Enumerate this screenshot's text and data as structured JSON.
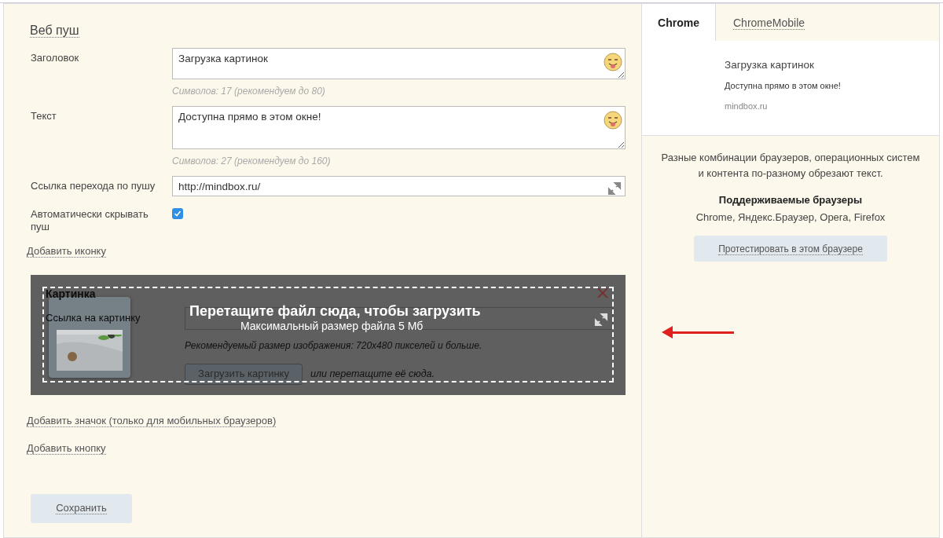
{
  "section_title": "Веб пуш",
  "fields": [
    {
      "kind": "textarea",
      "label": "Заголовок",
      "value": "Загрузка картинок",
      "hint": "Символов: 17 (рекомендуем до 80)"
    },
    {
      "kind": "textarea",
      "label": "Текст",
      "value": "Доступна прямо в этом окне!",
      "hint": "Символов: 27 (рекомендуем до 160)"
    },
    {
      "kind": "input",
      "label": "Ссылка перехода по пушу",
      "value": "http://mindbox.ru/"
    },
    {
      "kind": "checkbox",
      "label": "Автоматически скрывать пуш",
      "checked": true
    }
  ],
  "add_icon_link": "Добавить иконку",
  "image_block": {
    "title": "Картинка",
    "label": "Ссылка на картинку",
    "hint": "Рекомендуемый размер изображения: 720x480 пикселей и больше.",
    "upload_button": "Загрузить картинку",
    "drop_note": "или перетащите её сюда.",
    "drop_overlay": {
      "title": "Перетащите файл сюда, чтобы загрузить",
      "subtitle": "Максимальный размер файла 5 Мб"
    }
  },
  "links": [
    "Добавить значок (только для мобильных браузеров)",
    "Добавить кнопку"
  ],
  "save_button": "Сохранить",
  "preview": {
    "tabs": [
      {
        "label": "Chrome",
        "selected": true
      },
      {
        "label": "ChromeMobile",
        "selected": false
      }
    ],
    "title": "Загрузка картинок",
    "text": "Доступна прямо в этом окне!",
    "domain": "mindbox.ru",
    "note": "Разные комбинации браузеров, операционных систем и контента по-разному обрезают текст.",
    "supported_title": "Поддерживаемые браузеры",
    "supported_list": "Chrome, Яндекс.Браузер, Opera, Firefox",
    "test_button": "Протестировать в этом браузере"
  }
}
